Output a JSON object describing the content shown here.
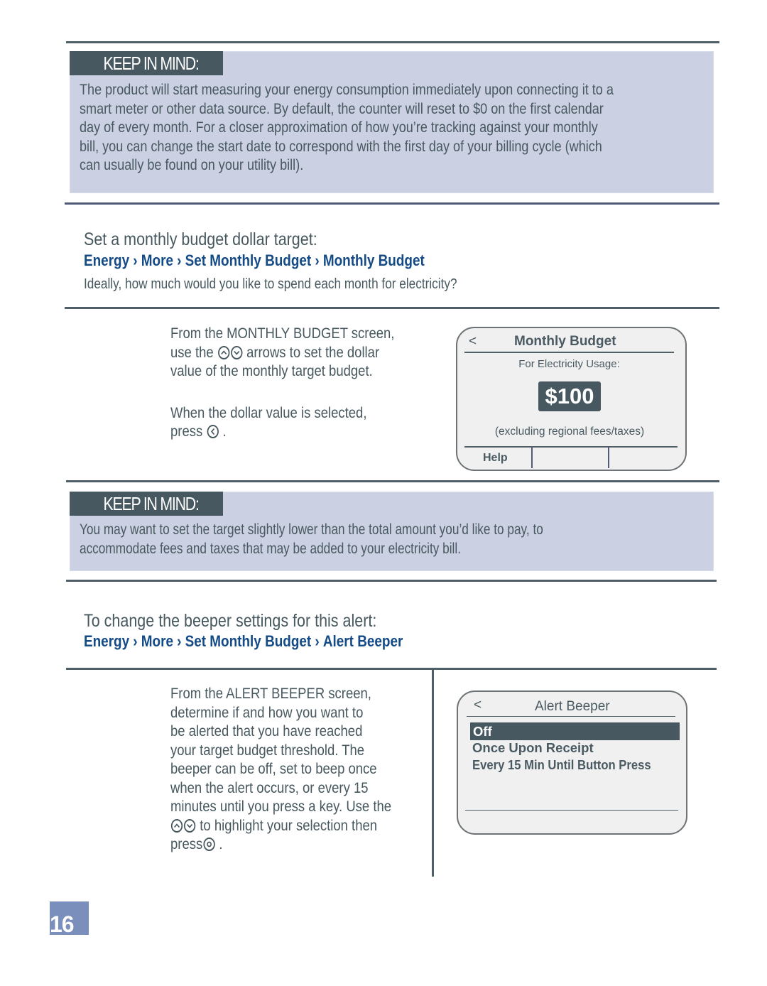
{
  "keep_in_mind_1": {
    "tag": "KEEP IN MIND:",
    "lines": [
      "The product will start measuring your energy consumption immediately upon connecting it to a",
      "smart meter or other data source. By default, the counter will reset to $0 on the first calendar",
      "day of every month. For a closer approximation of how you’re tracking against your monthly",
      "bill, you can change the start date to correspond with the first day of your billing cycle (which",
      "can usually be found on your utility bill)."
    ]
  },
  "budget_section": {
    "heading": "Set a monthly budget dollar target:",
    "breadcrumb": [
      "Energy",
      "More",
      "Set Monthly Budget",
      "Monthly Budget"
    ],
    "separator": "›",
    "question": "Ideally, how much would you like to spend each month for electricity?",
    "instructions": {
      "line1": "From the MONTHLY BUDGET screen,",
      "line2_pre": "use the",
      "line2_post": "arrows to set the dollar",
      "line3": "value of the monthly target budget.",
      "line4": "When the dollar value is selected,",
      "line5_pre": "press",
      "line5_post": "."
    },
    "device": {
      "back": "<",
      "title": "Monthly Budget",
      "label": "For Electricity Usage:",
      "value": "$100",
      "note": "(excluding regional fees/taxes)",
      "softkeys": [
        "Help",
        "",
        ""
      ]
    }
  },
  "keep_in_mind_2": {
    "tag": "KEEP IN MIND:",
    "lines": [
      "You may want to set the target slightly lower than the total amount you’d like to pay, to",
      "accommodate fees and taxes that may be added to your electricity bill."
    ]
  },
  "beeper_section": {
    "heading": "To change the beeper settings for this alert:",
    "breadcrumb": [
      "Energy",
      "More",
      "Set Monthly Budget",
      "Alert Beeper"
    ],
    "separator": "›",
    "instructions": {
      "lines": [
        "From the ALERT BEEPER screen,",
        "determine if and how you want to",
        "be alerted that you have reached",
        "your target budget threshold. The",
        "beeper can be off, set to beep once",
        "when the alert occurs, or every 15",
        "minutes until you press a key. Use the"
      ],
      "line8_post": "to highlight your selection then",
      "line9_pre": "press",
      "line9_post": "."
    },
    "device": {
      "back": "<",
      "title": "Alert Beeper",
      "options": [
        "Off",
        "Once Upon Receipt",
        "Every 15 Min Until Button Press"
      ],
      "selected_index": 0
    }
  },
  "page_number": "16",
  "colors": {
    "callout_bg": "#cbd1e3",
    "tag_bg": "#475861",
    "breadcrumb": "#144a86",
    "body_text": "#47585f",
    "page_badge": "#7b8fbd"
  }
}
